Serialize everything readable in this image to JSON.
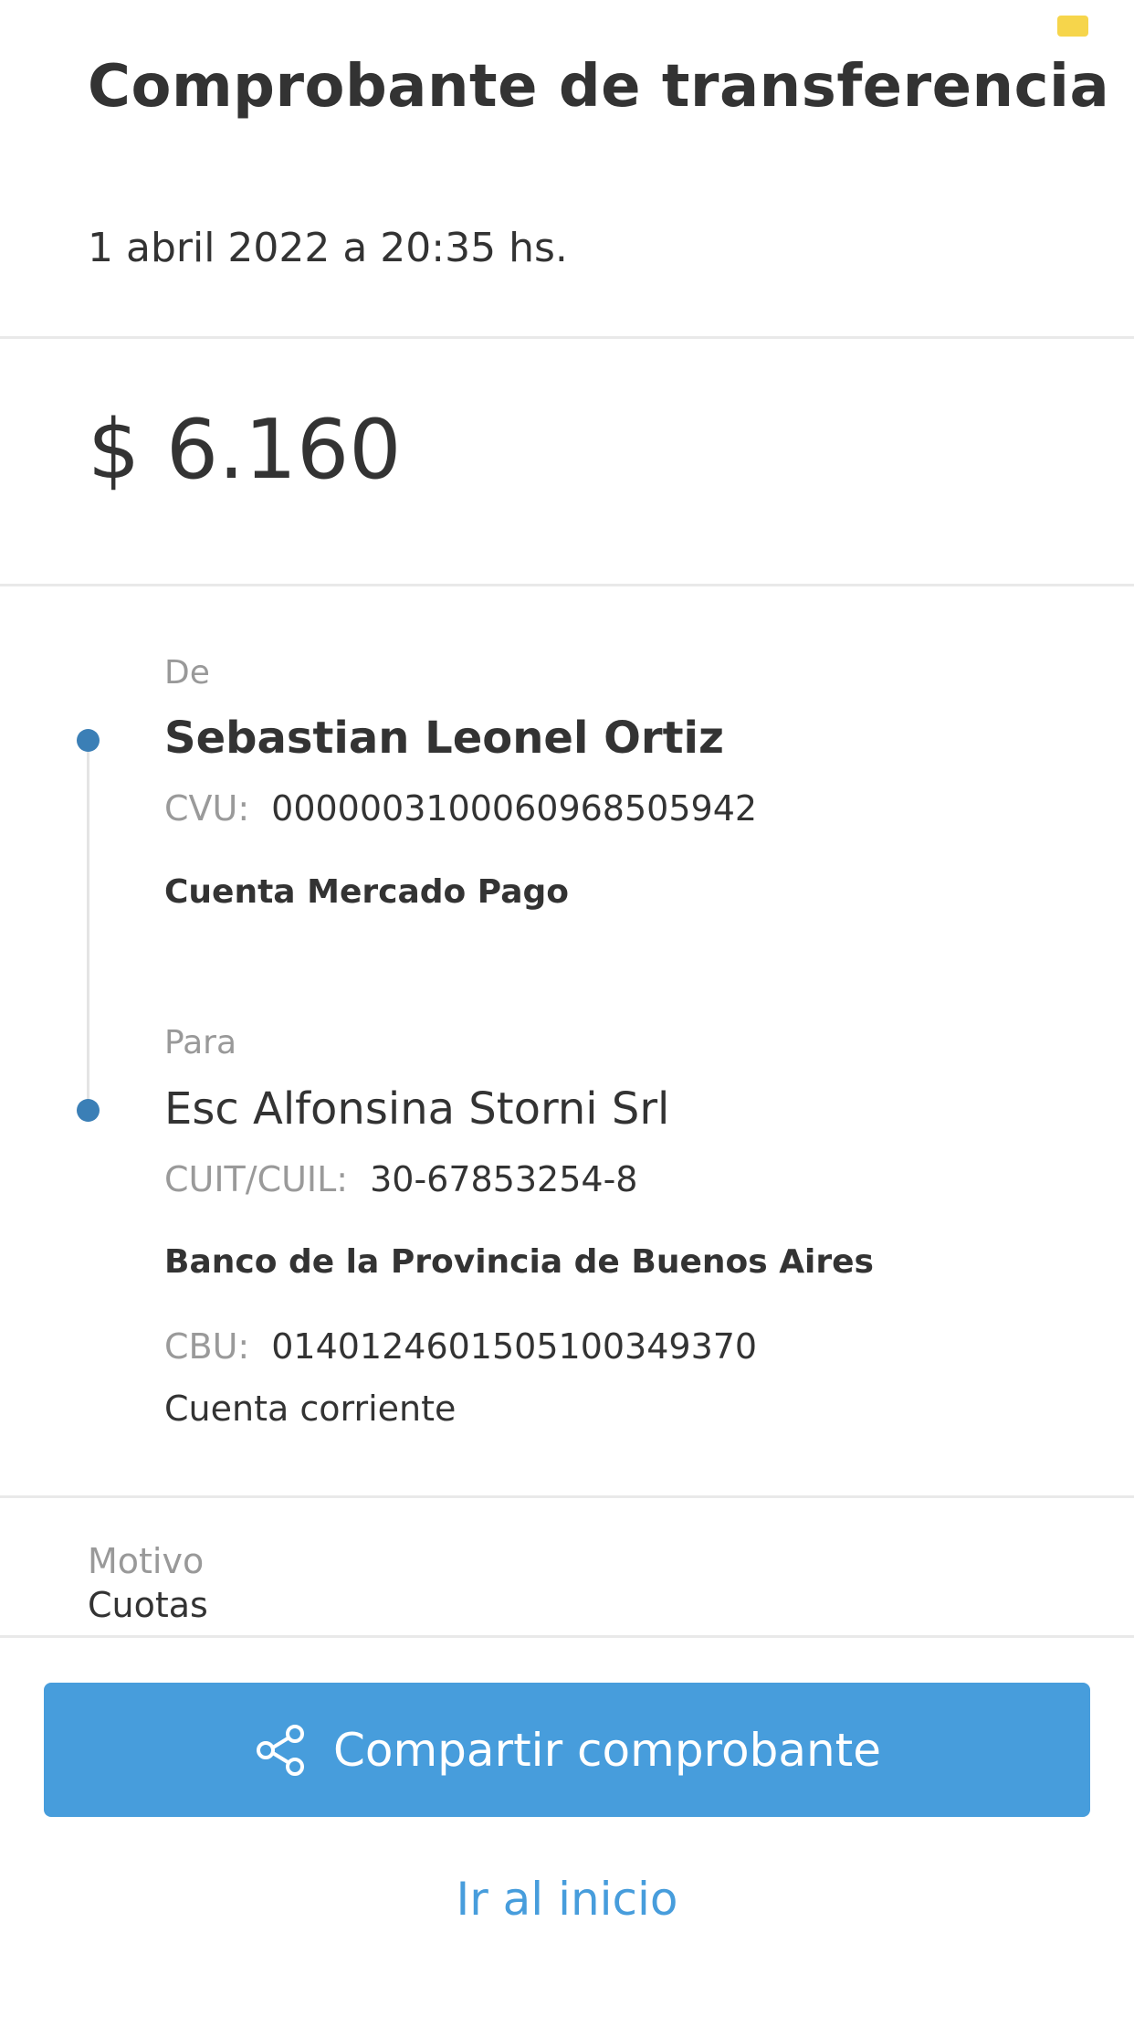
{
  "header": {
    "title": "Comprobante de transferencia",
    "datetime": "1 abril 2022 a 20:35 hs."
  },
  "amount": "$ 6.160",
  "from": {
    "label": "De",
    "name": "Sebastian Leonel Ortiz",
    "id_label": "CVU:",
    "id_value": "0000003100060968505942",
    "account": "Cuenta Mercado Pago"
  },
  "to": {
    "label": "Para",
    "name": "Esc Alfonsina Storni Srl",
    "id_label": "CUIT/CUIL:",
    "id_value": "30-67853254-8",
    "bank": "Banco de la Provincia de Buenos Aires",
    "cbu_label": "CBU:",
    "cbu_value": "0140124601505100349370",
    "account_type": "Cuenta corriente"
  },
  "motivo": {
    "label": "Motivo",
    "value": "Cuotas"
  },
  "actions": {
    "share_label": "Compartir comprobante",
    "home_label": "Ir al inicio"
  },
  "colors": {
    "accent": "#479ddc",
    "timeline_dot": "#3b7fb6",
    "status_badge": "#f6d54b"
  },
  "icons": {
    "share": "share-icon"
  }
}
